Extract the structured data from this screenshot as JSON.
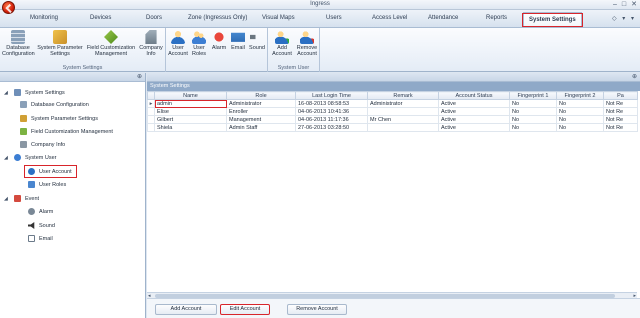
{
  "window": {
    "title": "Ingress",
    "controls": [
      "–",
      "□",
      "✕"
    ]
  },
  "menu": {
    "tabs": [
      "Monitoring",
      "Devices",
      "Doors",
      "Zone (Ingressus Only)",
      "Visual Maps",
      "Users",
      "Access Level",
      "Attendance",
      "Reports",
      "System Settings"
    ],
    "active": "System Settings",
    "tray": "◇ ▾ ▾"
  },
  "ribbon": {
    "groups": [
      {
        "label": "System Settings",
        "buttons": [
          {
            "line1": "Database",
            "line2": "Configuration",
            "icon": "database-icon"
          },
          {
            "line1": "System Parameter",
            "line2": "Settings",
            "icon": "parameter-icon"
          },
          {
            "line1": "Field Customization",
            "line2": "Management",
            "icon": "field-icon"
          },
          {
            "line1": "Company",
            "line2": "Info",
            "icon": "company-icon"
          }
        ]
      },
      {
        "label": "",
        "buttons": [
          {
            "line1": "User",
            "line2": "Account",
            "icon": "user-icon"
          },
          {
            "line1": "User",
            "line2": "Roles",
            "icon": "roles-icon"
          },
          {
            "line1": "Alarm",
            "line2": "",
            "icon": "alarm-icon"
          },
          {
            "line1": "Email",
            "line2": "",
            "icon": "email-icon"
          },
          {
            "line1": "Sound",
            "line2": "",
            "icon": "sound-icon"
          }
        ]
      },
      {
        "label": "System User",
        "buttons": [
          {
            "line1": "Add",
            "line2": "Account",
            "icon": "add-account-icon"
          },
          {
            "line1": "Remove",
            "line2": "Account",
            "icon": "remove-account-icon"
          }
        ]
      }
    ]
  },
  "tree": {
    "items": [
      {
        "label": "System Settings",
        "expander": "◢"
      },
      {
        "label": "Database Configuration"
      },
      {
        "label": "System Parameter Settings"
      },
      {
        "label": "Field Customization Management"
      },
      {
        "label": "Company Info"
      },
      {
        "label": "System User",
        "expander": "◢"
      },
      {
        "label": "User Account"
      },
      {
        "label": "User Roles"
      },
      {
        "label": "Event",
        "expander": "◢"
      },
      {
        "label": "Alarm"
      },
      {
        "label": "Sound"
      },
      {
        "label": "Email"
      }
    ]
  },
  "grid": {
    "title": "System Settings",
    "columns": [
      "Name",
      "Role",
      "Last Login Time",
      "Remark",
      "Account Status",
      "Fingerprint 1",
      "Fingerprint 2",
      "Pa"
    ],
    "rows": [
      {
        "name": "admin",
        "role": "Administrator",
        "last": "16-08-2013 08:58:53",
        "remark": "Administrator",
        "status": "Active",
        "fp1": "No",
        "fp2": "No",
        "pa": "Not Re"
      },
      {
        "name": "Elise",
        "role": "Enroller",
        "last": "04-06-2013 10:41:36",
        "remark": "",
        "status": "Active",
        "fp1": "No",
        "fp2": "No",
        "pa": "Not Re"
      },
      {
        "name": "Gilbert",
        "role": "Management",
        "last": "04-06-2013 11:17:36",
        "remark": "Mr Chen",
        "status": "Active",
        "fp1": "No",
        "fp2": "No",
        "pa": "Not Re"
      },
      {
        "name": "Shiela",
        "role": "Admin Staff",
        "last": "27-06-2013 03:28:50",
        "remark": "",
        "status": "Active",
        "fp1": "No",
        "fp2": "No",
        "pa": "Not Re"
      }
    ]
  },
  "actions": {
    "add": "Add Account",
    "edit": "Edit Account",
    "remove": "Remove Account"
  },
  "pin": "⊕",
  "selector": "▸",
  "scroll_left": "◂",
  "scroll_right": "▸"
}
